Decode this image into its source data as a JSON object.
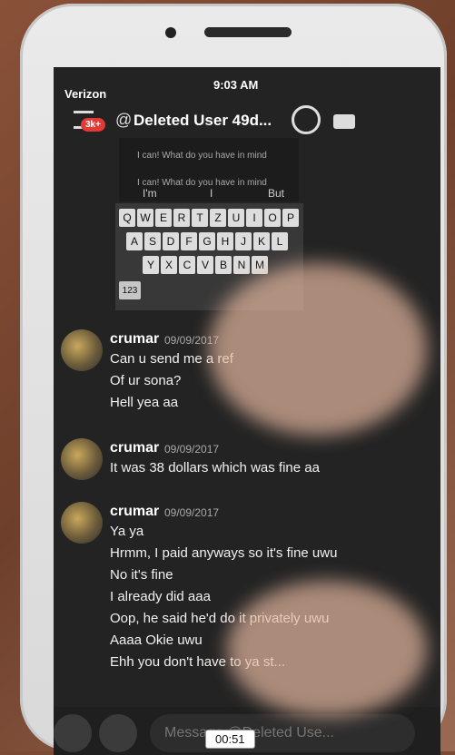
{
  "status_bar": {
    "carrier": "Verizon",
    "time": "9:03 AM"
  },
  "header": {
    "notification_count": "3k+",
    "title": "Deleted User 49d...",
    "at_symbol": "@"
  },
  "keyboard": {
    "rows": [
      [
        "Q",
        "W",
        "E",
        "R",
        "T",
        "Z",
        "U",
        "I",
        "O",
        "P"
      ],
      [
        "A",
        "S",
        "D",
        "F",
        "G",
        "H",
        "J",
        "K",
        "L"
      ],
      [
        "Y",
        "X",
        "C",
        "V",
        "B",
        "N",
        "M"
      ]
    ],
    "left_special": "123",
    "predictions": [
      "I'm",
      "I",
      "But"
    ]
  },
  "ghost_preview": {
    "line1": "I can! What do you have in mind",
    "line2": "I can! What do you have in mind"
  },
  "messages": [
    {
      "author": "crumar",
      "date": "09/09/2017",
      "lines": [
        "Can u send me a ref",
        "Of ur sona?",
        "Hell yea aa"
      ]
    },
    {
      "author": "crumar",
      "date": "09/09/2017",
      "lines": [
        "It was 38 dollars which was fine aa"
      ]
    },
    {
      "author": "crumar",
      "date": "09/09/2017",
      "lines": [
        "Ya ya",
        "Hrmm, I paid anyways so it's fine uwu",
        "No it's fine",
        "I already did aaa",
        "Oop, he said he'd do it privately uwu",
        "Aaaa Okie uwu",
        "Ehh you don't have to ya st..."
      ]
    }
  ],
  "input": {
    "placeholder": "Message @Deleted Use..."
  },
  "video_timestamp": "00:51"
}
